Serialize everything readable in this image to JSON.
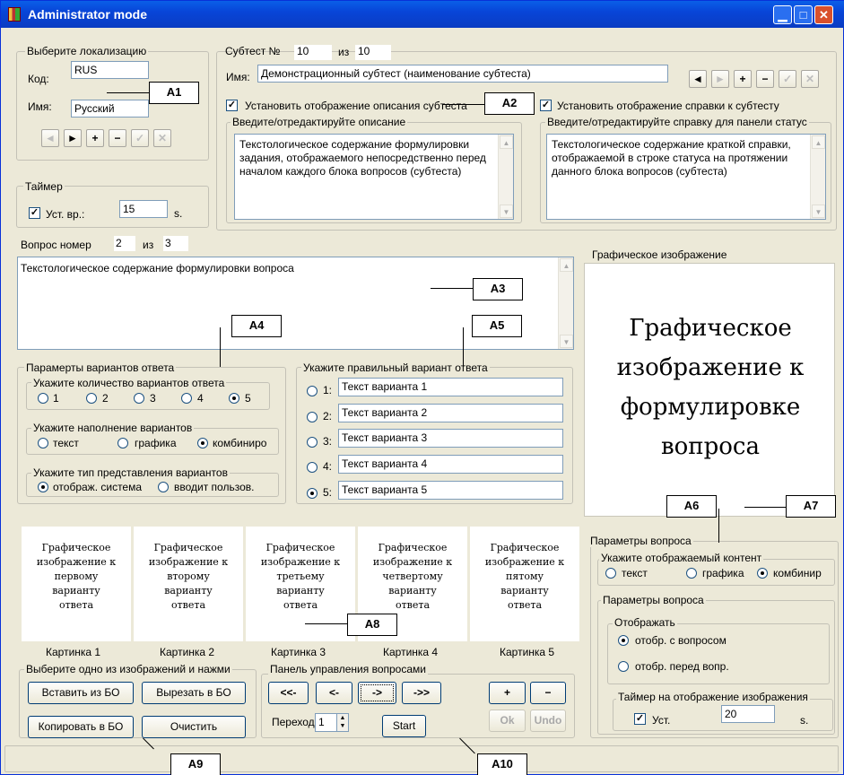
{
  "window": {
    "title": "Administrator mode"
  },
  "localization": {
    "legend": "Выберите локализацию",
    "code_label": "Код:",
    "code_value": "RUS",
    "name_label": "Имя:",
    "name_value": "Русский",
    "nav": [
      "◄",
      "►",
      "+",
      "−",
      "✓",
      "✕"
    ]
  },
  "timer": {
    "legend": "Таймер",
    "checkbox_label": "Уст. вр.:",
    "value": "15",
    "unit": "s."
  },
  "subtest": {
    "number_label": "Субтест №",
    "number": "10",
    "of_label": "из",
    "total": "10",
    "name_label": "Имя:",
    "name_value": "Демонстрационный субтест (наименование субтеста)",
    "nav": [
      "◄",
      "►",
      "+",
      "−",
      "✓",
      "✕"
    ],
    "show_desc_label": "Установить отображение описания субтеста",
    "desc_legend": "Введите/отредактируйте описание",
    "desc_text": "Текстологическое содержание формулировки задания, отображаемого непосредственно перед началом каждого блока вопросов (субтеста)",
    "show_help_label": "Установить отображение справки к субтесту",
    "help_legend": "Введите/отредактируйте справку для панели статус",
    "help_text": "Текстологическое содержание краткой справки, отображаемой в строке статуса на протяжении данного блока вопросов (субтеста)"
  },
  "question": {
    "number_label": "Вопрос номер",
    "number": "2",
    "of_label": "из",
    "total": "3",
    "text": "Текстологическое содержание формулировки вопроса"
  },
  "answer_params": {
    "legend": "Парамерты вариантов ответа",
    "count_legend": "Укажите количество вариантов ответа",
    "counts": [
      "1",
      "2",
      "3",
      "4",
      "5"
    ],
    "selected_count": "5",
    "fill_legend": "Укажите наполнение вариантов",
    "fill_text": "текст",
    "fill_graphics": "графика",
    "fill_combined": "комбиниро",
    "type_legend": "Укажите тип представления вариантов",
    "type_system": "отображ. система",
    "type_user": "вводит пользов."
  },
  "correct_answer": {
    "legend": "Укажите правильный вариант ответа",
    "options": [
      {
        "num": "1:",
        "text": "Текст варианта 1"
      },
      {
        "num": "2:",
        "text": "Текст варианта 2"
      },
      {
        "num": "3:",
        "text": "Текст варианта 3"
      },
      {
        "num": "4:",
        "text": "Текст варианта 4"
      },
      {
        "num": "5:",
        "text": "Текст варианта 5"
      }
    ],
    "selected": "5"
  },
  "graphic": {
    "label": "Графическое изображение",
    "lines": [
      "Графическое",
      "изображение к",
      "формулировке",
      "вопроса"
    ]
  },
  "question_params": {
    "legend": "Параметры вопроса",
    "content_legend": "Укажите отображаемый контент",
    "content_text": "текст",
    "content_graphics": "графика",
    "content_combined": "комбинир",
    "inner_legend": "Параметры вопроса",
    "display_legend": "Отображать",
    "with_question": "отобр. с вопросом",
    "before_question": "отобр. перед вопр.",
    "img_timer_legend": "Таймер на отображение изображения",
    "img_timer_label": "Уст.",
    "img_timer_value": "20",
    "img_timer_unit": "s."
  },
  "answer_images": [
    {
      "lines": [
        "Графическое",
        "изображение к",
        "первому",
        "варианту",
        "ответа"
      ],
      "label": "Картинка 1"
    },
    {
      "lines": [
        "Графическое",
        "изображение к",
        "второму",
        "варианту",
        "ответа"
      ],
      "label": "Картинка 2"
    },
    {
      "lines": [
        "Графическое",
        "изображение к",
        "третьему",
        "варианту",
        "ответа"
      ],
      "label": "Картинка 3"
    },
    {
      "lines": [
        "Графическое",
        "изображение к",
        "четвертому",
        "варианту",
        "ответа"
      ],
      "label": "Картинка 4"
    },
    {
      "lines": [
        "Графическое",
        "изображение к",
        "пятому",
        "варианту",
        "ответа"
      ],
      "label": "Картинка 5"
    }
  ],
  "image_ops": {
    "legend": "Выберите одно из изображений и нажми",
    "insert": "Вставить из БО",
    "cut": "Вырезать в БО",
    "copy": "Копировать в БО",
    "clear": "Очистить"
  },
  "question_panel": {
    "legend": "Панель управления вопросами",
    "first": "<<-",
    "prev": "<-",
    "next": "->",
    "last": "->>",
    "add": "+",
    "remove": "−",
    "ok": "Ok",
    "undo": "Undo",
    "goto_label": "Переход",
    "goto_value": "1",
    "start": "Start"
  },
  "callouts": [
    "A1",
    "A2",
    "A3",
    "A4",
    "A5",
    "A6",
    "A7",
    "A8",
    "A9",
    "A10"
  ]
}
